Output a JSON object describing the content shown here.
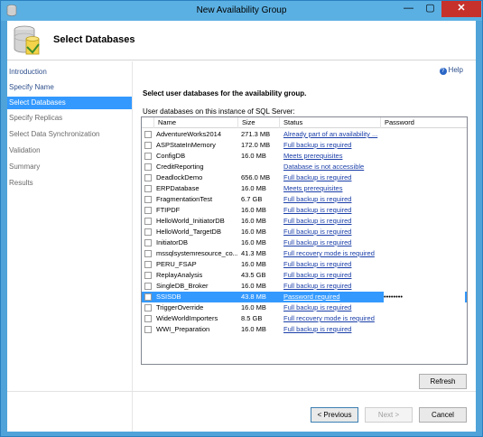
{
  "window": {
    "title": "New Availability Group"
  },
  "header": {
    "title": "Select Databases"
  },
  "sidebar": {
    "items": [
      {
        "label": "Introduction",
        "state": "done"
      },
      {
        "label": "Specify Name",
        "state": "done"
      },
      {
        "label": "Select Databases",
        "state": "active"
      },
      {
        "label": "Specify Replicas",
        "state": "pending"
      },
      {
        "label": "Select Data Synchronization",
        "state": "pending"
      },
      {
        "label": "Validation",
        "state": "pending"
      },
      {
        "label": "Summary",
        "state": "pending"
      },
      {
        "label": "Results",
        "state": "pending"
      }
    ]
  },
  "help": {
    "label": "Help"
  },
  "main": {
    "instruction": "Select user databases for the availability group.",
    "list_label": "User databases on this instance of SQL Server:",
    "columns": [
      "Name",
      "Size",
      "Status",
      "Password"
    ],
    "rows": [
      {
        "name": "AdventureWorks2014",
        "size": "271.3 MB",
        "status": "Already part of an availability ...",
        "password": "",
        "checkbox": true,
        "link": true
      },
      {
        "name": "ASPStateInMemory",
        "size": "172.0 MB",
        "status": "Full backup is required",
        "password": "",
        "checkbox": true,
        "link": true
      },
      {
        "name": "ConfigDB",
        "size": "16.0 MB",
        "status": "Meets prerequisites",
        "password": "",
        "checkbox": true,
        "link": true
      },
      {
        "name": "CreditReporting",
        "size": "",
        "status": "Database is not accessible",
        "password": "",
        "checkbox": true,
        "link": true
      },
      {
        "name": "DeadlockDemo",
        "size": "656.0 MB",
        "status": "Full backup is required",
        "password": "",
        "checkbox": true,
        "link": true
      },
      {
        "name": "ERPDatabase",
        "size": "16.0 MB",
        "status": "Meets prerequisites",
        "password": "",
        "checkbox": true,
        "link": true
      },
      {
        "name": "FragmentationTest",
        "size": "6.7 GB",
        "status": "Full backup is required",
        "password": "",
        "checkbox": true,
        "link": true
      },
      {
        "name": "FTIPDF",
        "size": "16.0 MB",
        "status": "Full backup is required",
        "password": "",
        "checkbox": true,
        "link": true
      },
      {
        "name": "HelloWorld_InitiatorDB",
        "size": "16.0 MB",
        "status": "Full backup is required",
        "password": "",
        "checkbox": true,
        "link": true
      },
      {
        "name": "HelloWorld_TargetDB",
        "size": "16.0 MB",
        "status": "Full backup is required",
        "password": "",
        "checkbox": true,
        "link": true
      },
      {
        "name": "InitiatorDB",
        "size": "16.0 MB",
        "status": "Full backup is required",
        "password": "",
        "checkbox": true,
        "link": true
      },
      {
        "name": "mssqlsystemresource_co...",
        "size": "41.3 MB",
        "status": "Full recovery mode is required",
        "password": "",
        "checkbox": true,
        "link": true
      },
      {
        "name": "PERU_FSAP",
        "size": "16.0 MB",
        "status": "Full backup is required",
        "password": "",
        "checkbox": true,
        "link": true
      },
      {
        "name": "ReplayAnalysis",
        "size": "43.5 GB",
        "status": "Full backup is required",
        "password": "",
        "checkbox": true,
        "link": true
      },
      {
        "name": "SingleDB_Broker",
        "size": "16.0 MB",
        "status": "Full backup is required",
        "password": "",
        "checkbox": true,
        "link": true
      },
      {
        "name": "SSISDB",
        "size": "43.8 MB",
        "status": "Password required",
        "password": "••••••••",
        "checkbox": true,
        "link": true,
        "selected": true
      },
      {
        "name": "TriggerOverride",
        "size": "16.0 MB",
        "status": "Full backup is required",
        "password": "",
        "checkbox": true,
        "link": true
      },
      {
        "name": "WideWorldImporters",
        "size": "8.5 GB",
        "status": "Full recovery mode is required",
        "password": "",
        "checkbox": true,
        "link": true
      },
      {
        "name": "WWI_Preparation",
        "size": "16.0 MB",
        "status": "Full backup is required",
        "password": "",
        "checkbox": true,
        "link": true
      }
    ]
  },
  "buttons": {
    "refresh": "Refresh",
    "previous": "< Previous",
    "next": "Next >",
    "cancel": "Cancel"
  },
  "titlebar_buttons": {
    "minimize": "—",
    "maximize": "▢",
    "close": "✕"
  },
  "colors": {
    "titlebar": "#5bb0e3",
    "selection": "#3399ff",
    "link": "#1a3ea8",
    "close": "#c7312b"
  }
}
